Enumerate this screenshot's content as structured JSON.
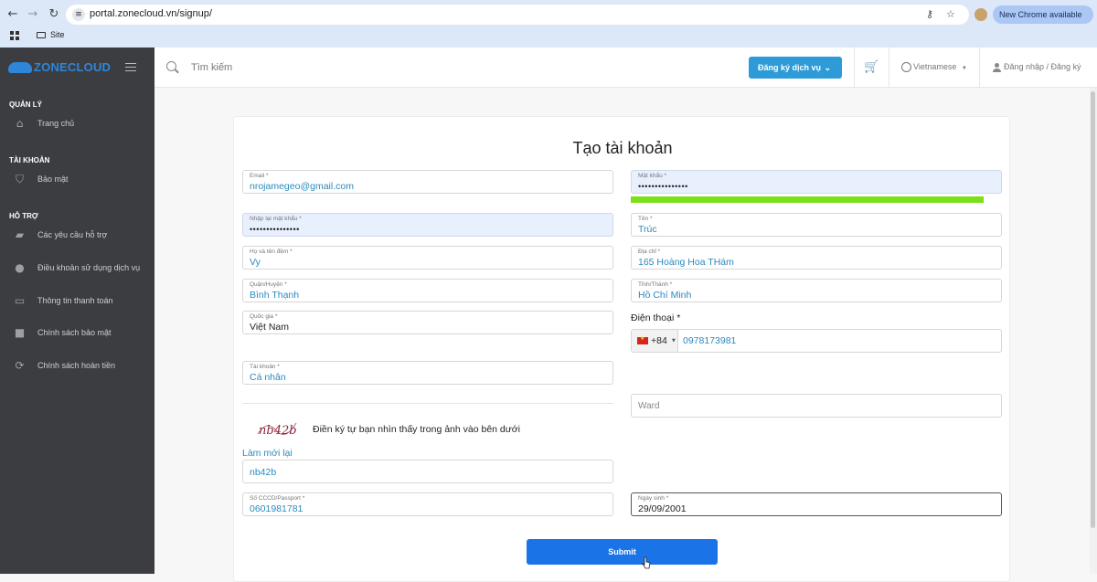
{
  "browser": {
    "url": "portal.zonecloud.vn/signup/",
    "update_label": "New Chrome available",
    "bookmark_folder": "Site"
  },
  "sidebar": {
    "brand_a": "ZONE",
    "brand_b": "CLOUD",
    "sections": [
      {
        "title": "QUẢN LÝ",
        "items": [
          {
            "label": "Trang chủ",
            "icon": "home-icon"
          }
        ]
      },
      {
        "title": "TÀI KHOẢN",
        "items": [
          {
            "label": "Bảo mật",
            "icon": "shield-icon"
          }
        ]
      },
      {
        "title": "HỖ TRỢ",
        "items": [
          {
            "label": "Các yêu cầu hỗ trợ",
            "icon": "tickets-icon"
          },
          {
            "label": "Điều khoản sử dụng dịch vụ",
            "icon": "user-icon"
          },
          {
            "label": "Thông tin thanh toán",
            "icon": "credit-card-icon"
          },
          {
            "label": "Chính sách bảo mật",
            "icon": "lock-icon"
          },
          {
            "label": "Chính sách hoàn tiền",
            "icon": "refresh-icon"
          }
        ]
      }
    ]
  },
  "topbar": {
    "search_placeholder": "Tìm kiếm",
    "register_service": "Đăng ký dịch vụ",
    "language": "Vietnamese",
    "login": "Đăng nhập / Đăng ký"
  },
  "form": {
    "title": "Tạo tài khoản",
    "email": {
      "label": "Email *",
      "value": "nrojamegeo@gmail.com"
    },
    "password": {
      "label": "Mật khẩu *",
      "value": "•••••••••••••••",
      "strength_fraction": 0.95
    },
    "confirm_password": {
      "label": "Nhập lại mật khẩu *",
      "value": "•••••••••••••••"
    },
    "first_name": {
      "label": "Tên *",
      "value": "Trúc"
    },
    "last_name": {
      "label": "Họ và tên đệm *",
      "value": "Vy"
    },
    "address": {
      "label": "Địa chỉ *",
      "value": "165 Hoàng Hoa THám"
    },
    "district": {
      "label": "Quận/Huyện *",
      "value": "Bình Thạnh"
    },
    "province": {
      "label": "Tỉnh/Thành *",
      "value": "Hồ Chí Minh"
    },
    "country": {
      "label": "Quốc gia *",
      "value": "Việt Nam"
    },
    "phone": {
      "label": "Điện thoại *",
      "code": "+84",
      "value": "0978173981"
    },
    "account_type": {
      "label": "Tài khoản *",
      "value": "Cá nhân"
    },
    "ward": {
      "placeholder": "Ward"
    },
    "captcha": {
      "image_text": "nb42b",
      "hint": "Điền ký tự bạn nhìn thấy trong ảnh vào bên dưới",
      "refresh": "Làm mới lại",
      "value": "nb42b"
    },
    "id_number": {
      "label": "Số CCCD/Passport *",
      "value": "0601981781"
    },
    "birthday": {
      "label": "Ngày sinh *",
      "value": "29/09/2001"
    },
    "submit": "Submit"
  },
  "colors": {
    "sidebar_bg": "#3c3d41",
    "brand": "#2f86d8",
    "accent_button": "#1b73e8",
    "register_button": "#2d9bd8",
    "strength_bar": "#7be019",
    "value_text": "#2a8ac0"
  }
}
